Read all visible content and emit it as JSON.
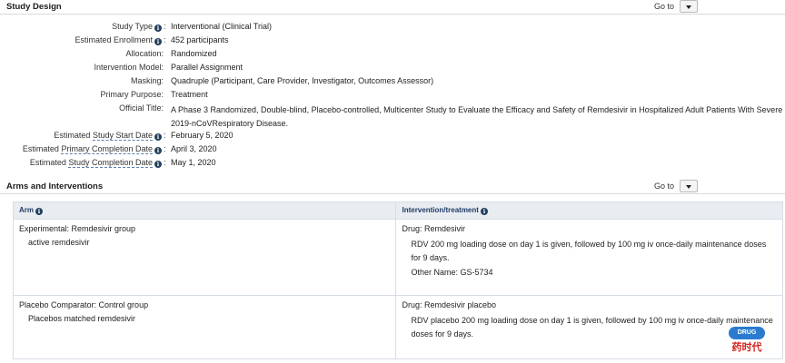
{
  "study_design": {
    "title": "Study Design",
    "goto_label": "Go to",
    "rows": [
      {
        "label": "Study Type",
        "info": true,
        "value": "Interventional  (Clinical Trial)"
      },
      {
        "label": "Estimated Enrollment",
        "info": true,
        "value": "452 participants"
      },
      {
        "label": "Allocation:",
        "info": false,
        "value": "Randomized"
      },
      {
        "label": "Intervention Model:",
        "info": false,
        "value": "Parallel Assignment"
      },
      {
        "label": "Masking:",
        "info": false,
        "value": "Quadruple (Participant, Care Provider, Investigator, Outcomes Assessor)"
      },
      {
        "label": "Primary Purpose:",
        "info": false,
        "value": "Treatment"
      },
      {
        "label": "Official Title:",
        "info": false,
        "value": "A Phase 3 Randomized, Double-blind, Placebo-controlled, Multicenter Study to Evaluate the Efficacy and Safety of Remdesivir in Hospitalized Adult Patients With Severe 2019-nCoVRespiratory Disease."
      },
      {
        "label_prefix": "Estimated ",
        "label_dotted": "Study Start Date",
        "info": true,
        "value": "February 5, 2020"
      },
      {
        "label_prefix": "Estimated ",
        "label_dotted": "Primary Completion Date",
        "info": true,
        "value": "April 3, 2020"
      },
      {
        "label_prefix": "Estimated ",
        "label_dotted": "Study Completion Date",
        "info": true,
        "value": "May 1, 2020"
      }
    ]
  },
  "arms": {
    "title": "Arms and Interventions",
    "goto_label": "Go to",
    "col_arm": "Arm",
    "col_intervention": "Intervention/treatment",
    "rows": [
      {
        "arm_title": "Experimental: Remdesivir group",
        "arm_desc": "active remdesivir",
        "int_title": "Drug: Remdesivir",
        "int_desc": "RDV 200 mg loading dose on day 1 is given, followed by 100 mg iv once-daily maintenance doses for 9 days.",
        "int_other": "Other Name: GS-5734"
      },
      {
        "arm_title": "Placebo Comparator: Control group",
        "arm_desc": "Placebos matched remdesivir",
        "int_title": "Drug: Remdesivir placebo",
        "int_desc": "RDV placebo 200 mg loading dose on day 1 is given, followed by 100 mg iv once-daily maintenance doses for 9 days.",
        "int_other": ""
      }
    ]
  },
  "watermark": {
    "badge": "DRUG TIMES",
    "cn": "药时代"
  }
}
